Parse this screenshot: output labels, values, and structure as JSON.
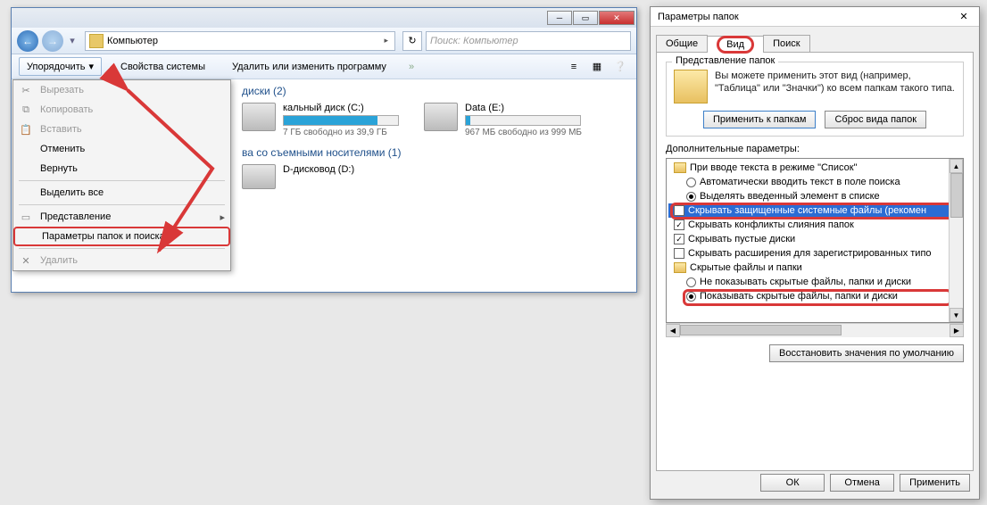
{
  "explorer": {
    "breadcrumb": "Компьютер",
    "search_placeholder": "Поиск: Компьютер",
    "toolbar": {
      "organize": "Упорядочить",
      "properties": "Свойства системы",
      "uninstall": "Удалить или изменить программу",
      "more": "»"
    },
    "menu": {
      "cut": "Вырезать",
      "copy": "Копировать",
      "paste": "Вставить",
      "undo": "Отменить",
      "redo": "Вернуть",
      "select_all": "Выделить все",
      "layout": "Представление",
      "folder_opts": "Параметры папок и поиска",
      "delete": "Удалить"
    },
    "section_disks": "диски (2)",
    "section_removable": "ва со съемными носителями (1)",
    "drives": [
      {
        "name": "кальный диск (C:)",
        "sub": "7 ГБ свободно из 39,9 ГБ",
        "fill": 82,
        "color": "#2aa3d8"
      },
      {
        "name": "Data (E:)",
        "sub": "967 МБ свободно из 999 МБ",
        "fill": 4,
        "color": "#2aa3d8"
      }
    ],
    "dvd": "D-дисковод (D:)"
  },
  "dialog": {
    "title": "Параметры папок",
    "tabs": {
      "general": "Общие",
      "view": "Вид",
      "search": "Поиск"
    },
    "group_view": {
      "label": "Представление папок",
      "text": "Вы можете применить этот вид (например, \"Таблица\" или \"Значки\") ко всем папкам такого типа.",
      "apply": "Применить к папкам",
      "reset": "Сброс вида папок"
    },
    "params_label": "Дополнительные параметры:",
    "tree": {
      "n0": "При вводе текста в режиме \"Список\"",
      "n1": "Автоматически вводить текст в поле поиска",
      "n2": "Выделять введенный элемент в списке",
      "n3": "Скрывать защищенные системные файлы (рекомен",
      "n4": "Скрывать конфликты слияния папок",
      "n5": "Скрывать пустые диски",
      "n6": "Скрывать расширения для зарегистрированных типо",
      "n7": "Скрытые файлы и папки",
      "n8": "Не показывать скрытые файлы, папки и диски",
      "n9": "Показывать скрытые файлы, папки и диски"
    },
    "restore": "Восстановить значения по умолчанию",
    "ok": "ОК",
    "cancel": "Отмена",
    "apply": "Применить"
  }
}
